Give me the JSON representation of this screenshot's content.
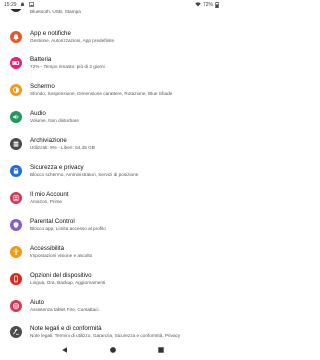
{
  "status_bar": {
    "time": "15:29",
    "battery": "72%",
    "left_icons": [
      "notification-icon",
      "image-icon"
    ],
    "right_icons": [
      "wifi-icon",
      "battery-icon"
    ]
  },
  "settings": [
    {
      "name": "row-connessioni",
      "title": "",
      "subtitle": "Bluetooth, USB, Stampa",
      "icon": "devices-icon",
      "color": "#2d2d2d"
    },
    {
      "name": "row-app-notifiche",
      "title": "App e notifiche",
      "subtitle": "Gestione, Autorizzazioni, App predefinite",
      "icon": "bell-icon",
      "color": "#e8572a"
    },
    {
      "name": "row-batteria",
      "title": "Batteria",
      "subtitle": "72% - Tempo rimasto: più di 2 giorni",
      "icon": "battery-icon",
      "color": "#e9207d"
    },
    {
      "name": "row-schermo",
      "title": "Schermo",
      "subtitle": "Sfondo, Sospensione, Dimensione carattere, Rotazione, Blue Shade",
      "icon": "brightness-icon",
      "color": "#f59a1b"
    },
    {
      "name": "row-audio",
      "title": "Audio",
      "subtitle": "Volume, Non disturbare",
      "icon": "speaker-icon",
      "color": "#1f9a5a"
    },
    {
      "name": "row-archiviazione",
      "title": "Archiviazione",
      "subtitle": "Utilizzati: 9% - Liberi: 54,45 GB",
      "icon": "storage-icon",
      "color": "#4a4a4a"
    },
    {
      "name": "row-sicurezza",
      "title": "Sicurezza e privacy",
      "subtitle": "Blocco schermo, Amministratori, Servizi di posizione",
      "icon": "lock-icon",
      "color": "#1e6fd9"
    },
    {
      "name": "row-account",
      "title": "Il mio Account",
      "subtitle": "Amazon, Prime",
      "icon": "person-icon",
      "color": "#cf3a5a"
    },
    {
      "name": "row-parental",
      "title": "Parental Control",
      "subtitle": "Blocco app, Limita accesso al profilo",
      "icon": "shield-icon",
      "color": "#8a5cc8"
    },
    {
      "name": "row-accessibilita",
      "title": "Accessibilità",
      "subtitle": "Impostazioni visione e ascolto",
      "icon": "accessibility-icon",
      "color": "#f29a12"
    },
    {
      "name": "row-opzioni",
      "title": "Opzioni del dispositivo",
      "subtitle": "Lingua, Ora, Backup, Aggiornamenti",
      "icon": "device-icon",
      "color": "#e0261b"
    },
    {
      "name": "row-aiuto",
      "title": "Aiuto",
      "subtitle": "Assistenza tablet Fire, Contattaci",
      "icon": "help-icon",
      "color": "#d33a55"
    },
    {
      "name": "row-note-legali",
      "title": "Note legali e di conformità",
      "subtitle": "Note legali, Termini di utilizzo, Garanzia, Sicurezza e conformità, Privacy",
      "icon": "gavel-icon",
      "color": "#4d4d4d"
    }
  ],
  "nav_bar": {
    "buttons": [
      "back-icon",
      "home-icon",
      "recents-icon"
    ]
  }
}
